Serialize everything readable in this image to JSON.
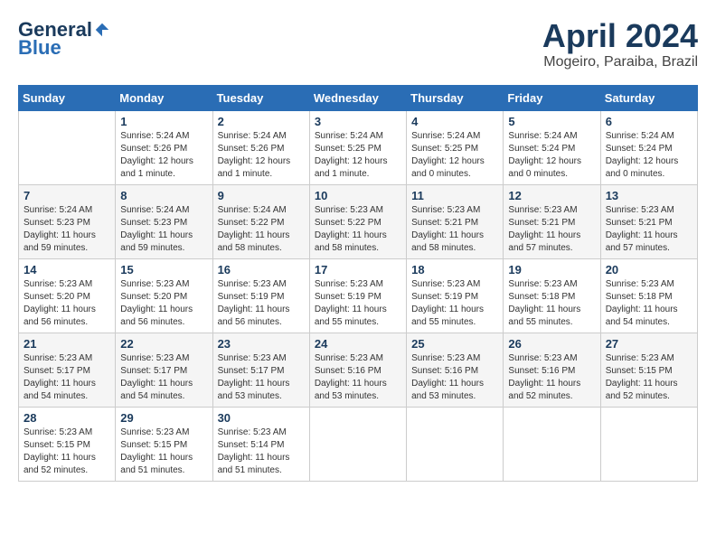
{
  "header": {
    "logo_general": "General",
    "logo_blue": "Blue",
    "month_title": "April 2024",
    "location": "Mogeiro, Paraiba, Brazil"
  },
  "weekdays": [
    "Sunday",
    "Monday",
    "Tuesday",
    "Wednesday",
    "Thursday",
    "Friday",
    "Saturday"
  ],
  "weeks": [
    [
      {
        "day": "",
        "sunrise": "",
        "sunset": "",
        "daylight": ""
      },
      {
        "day": "1",
        "sunrise": "Sunrise: 5:24 AM",
        "sunset": "Sunset: 5:26 PM",
        "daylight": "Daylight: 12 hours and 1 minute."
      },
      {
        "day": "2",
        "sunrise": "Sunrise: 5:24 AM",
        "sunset": "Sunset: 5:26 PM",
        "daylight": "Daylight: 12 hours and 1 minute."
      },
      {
        "day": "3",
        "sunrise": "Sunrise: 5:24 AM",
        "sunset": "Sunset: 5:25 PM",
        "daylight": "Daylight: 12 hours and 1 minute."
      },
      {
        "day": "4",
        "sunrise": "Sunrise: 5:24 AM",
        "sunset": "Sunset: 5:25 PM",
        "daylight": "Daylight: 12 hours and 0 minutes."
      },
      {
        "day": "5",
        "sunrise": "Sunrise: 5:24 AM",
        "sunset": "Sunset: 5:24 PM",
        "daylight": "Daylight: 12 hours and 0 minutes."
      },
      {
        "day": "6",
        "sunrise": "Sunrise: 5:24 AM",
        "sunset": "Sunset: 5:24 PM",
        "daylight": "Daylight: 12 hours and 0 minutes."
      }
    ],
    [
      {
        "day": "7",
        "sunrise": "Sunrise: 5:24 AM",
        "sunset": "Sunset: 5:23 PM",
        "daylight": "Daylight: 11 hours and 59 minutes."
      },
      {
        "day": "8",
        "sunrise": "Sunrise: 5:24 AM",
        "sunset": "Sunset: 5:23 PM",
        "daylight": "Daylight: 11 hours and 59 minutes."
      },
      {
        "day": "9",
        "sunrise": "Sunrise: 5:24 AM",
        "sunset": "Sunset: 5:22 PM",
        "daylight": "Daylight: 11 hours and 58 minutes."
      },
      {
        "day": "10",
        "sunrise": "Sunrise: 5:23 AM",
        "sunset": "Sunset: 5:22 PM",
        "daylight": "Daylight: 11 hours and 58 minutes."
      },
      {
        "day": "11",
        "sunrise": "Sunrise: 5:23 AM",
        "sunset": "Sunset: 5:21 PM",
        "daylight": "Daylight: 11 hours and 58 minutes."
      },
      {
        "day": "12",
        "sunrise": "Sunrise: 5:23 AM",
        "sunset": "Sunset: 5:21 PM",
        "daylight": "Daylight: 11 hours and 57 minutes."
      },
      {
        "day": "13",
        "sunrise": "Sunrise: 5:23 AM",
        "sunset": "Sunset: 5:21 PM",
        "daylight": "Daylight: 11 hours and 57 minutes."
      }
    ],
    [
      {
        "day": "14",
        "sunrise": "Sunrise: 5:23 AM",
        "sunset": "Sunset: 5:20 PM",
        "daylight": "Daylight: 11 hours and 56 minutes."
      },
      {
        "day": "15",
        "sunrise": "Sunrise: 5:23 AM",
        "sunset": "Sunset: 5:20 PM",
        "daylight": "Daylight: 11 hours and 56 minutes."
      },
      {
        "day": "16",
        "sunrise": "Sunrise: 5:23 AM",
        "sunset": "Sunset: 5:19 PM",
        "daylight": "Daylight: 11 hours and 56 minutes."
      },
      {
        "day": "17",
        "sunrise": "Sunrise: 5:23 AM",
        "sunset": "Sunset: 5:19 PM",
        "daylight": "Daylight: 11 hours and 55 minutes."
      },
      {
        "day": "18",
        "sunrise": "Sunrise: 5:23 AM",
        "sunset": "Sunset: 5:19 PM",
        "daylight": "Daylight: 11 hours and 55 minutes."
      },
      {
        "day": "19",
        "sunrise": "Sunrise: 5:23 AM",
        "sunset": "Sunset: 5:18 PM",
        "daylight": "Daylight: 11 hours and 55 minutes."
      },
      {
        "day": "20",
        "sunrise": "Sunrise: 5:23 AM",
        "sunset": "Sunset: 5:18 PM",
        "daylight": "Daylight: 11 hours and 54 minutes."
      }
    ],
    [
      {
        "day": "21",
        "sunrise": "Sunrise: 5:23 AM",
        "sunset": "Sunset: 5:17 PM",
        "daylight": "Daylight: 11 hours and 54 minutes."
      },
      {
        "day": "22",
        "sunrise": "Sunrise: 5:23 AM",
        "sunset": "Sunset: 5:17 PM",
        "daylight": "Daylight: 11 hours and 54 minutes."
      },
      {
        "day": "23",
        "sunrise": "Sunrise: 5:23 AM",
        "sunset": "Sunset: 5:17 PM",
        "daylight": "Daylight: 11 hours and 53 minutes."
      },
      {
        "day": "24",
        "sunrise": "Sunrise: 5:23 AM",
        "sunset": "Sunset: 5:16 PM",
        "daylight": "Daylight: 11 hours and 53 minutes."
      },
      {
        "day": "25",
        "sunrise": "Sunrise: 5:23 AM",
        "sunset": "Sunset: 5:16 PM",
        "daylight": "Daylight: 11 hours and 53 minutes."
      },
      {
        "day": "26",
        "sunrise": "Sunrise: 5:23 AM",
        "sunset": "Sunset: 5:16 PM",
        "daylight": "Daylight: 11 hours and 52 minutes."
      },
      {
        "day": "27",
        "sunrise": "Sunrise: 5:23 AM",
        "sunset": "Sunset: 5:15 PM",
        "daylight": "Daylight: 11 hours and 52 minutes."
      }
    ],
    [
      {
        "day": "28",
        "sunrise": "Sunrise: 5:23 AM",
        "sunset": "Sunset: 5:15 PM",
        "daylight": "Daylight: 11 hours and 52 minutes."
      },
      {
        "day": "29",
        "sunrise": "Sunrise: 5:23 AM",
        "sunset": "Sunset: 5:15 PM",
        "daylight": "Daylight: 11 hours and 51 minutes."
      },
      {
        "day": "30",
        "sunrise": "Sunrise: 5:23 AM",
        "sunset": "Sunset: 5:14 PM",
        "daylight": "Daylight: 11 hours and 51 minutes."
      },
      {
        "day": "",
        "sunrise": "",
        "sunset": "",
        "daylight": ""
      },
      {
        "day": "",
        "sunrise": "",
        "sunset": "",
        "daylight": ""
      },
      {
        "day": "",
        "sunrise": "",
        "sunset": "",
        "daylight": ""
      },
      {
        "day": "",
        "sunrise": "",
        "sunset": "",
        "daylight": ""
      }
    ]
  ]
}
